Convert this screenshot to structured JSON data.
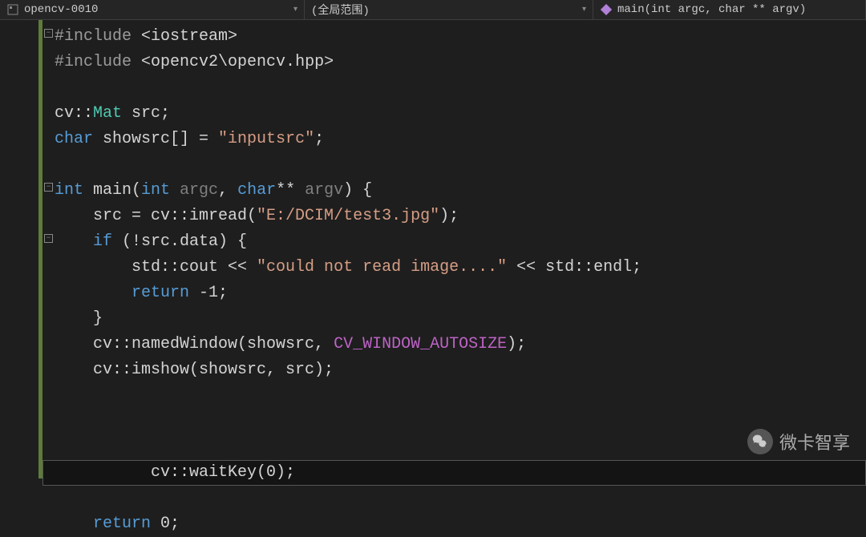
{
  "navbar": {
    "project": "opencv-0010",
    "scope": "(全局范围)",
    "function": "main(int argc, char ** argv)"
  },
  "code": {
    "line1_pre": "#include ",
    "line1_inc": "<iostream>",
    "line2_pre": "#include ",
    "line2_inc": "<opencv2\\opencv.hpp>",
    "line4_ns": "cv",
    "line4_sep": "::",
    "line4_type": "Mat",
    "line4_var": " src;",
    "line5_type": "char",
    "line5_var": " showsrc[] = ",
    "line5_str": "\"inputsrc\"",
    "line5_end": ";",
    "line7_type": "int",
    "line7_func": " main(",
    "line7_ptype1": "int",
    "line7_param1": " argc",
    "line7_comma": ", ",
    "line7_ptype2": "char",
    "line7_stars": "**",
    "line7_param2": " argv",
    "line7_close": ") {",
    "line8_indent": "    src = cv::imread(",
    "line8_str": "\"E:/DCIM/test3.jpg\"",
    "line8_end": ");",
    "line9_indent": "    ",
    "line9_kw": "if",
    "line9_cond": " (!src.data) {",
    "line10_indent": "        std::cout << ",
    "line10_str": "\"could not read image....\"",
    "line10_end": " << std::endl;",
    "line11_indent": "        ",
    "line11_kw": "return",
    "line11_val": " -1;",
    "line12": "    }",
    "line13_indent": "    cv::namedWindow(showsrc, ",
    "line13_macro": "CV_WINDOW_AUTOSIZE",
    "line13_end": ");",
    "line14": "    cv::imshow(showsrc, src);",
    "line16": "    cv::waitKey(0);",
    "line17_indent": "    ",
    "line17_kw": "return",
    "line17_val": " 0;"
  },
  "watermark": {
    "text": "微卡智享"
  }
}
